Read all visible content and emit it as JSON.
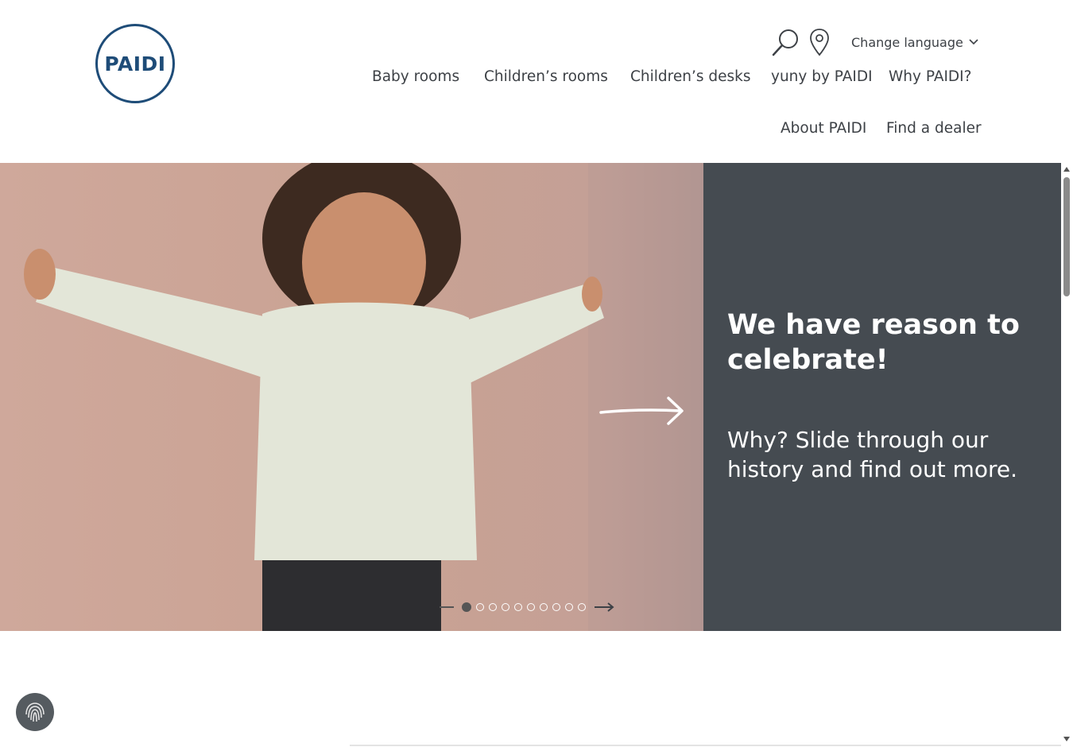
{
  "brand": {
    "logo_text": "PAIDI",
    "logo_color": "#1e4c78"
  },
  "header": {
    "utility": {
      "search_icon": "search-icon",
      "location_icon": "location-pin-icon",
      "language_label": "Change language"
    },
    "nav": [
      {
        "label": "Baby rooms"
      },
      {
        "label": "Children’s rooms"
      },
      {
        "label": "Children’s desks"
      },
      {
        "label": "yuny by PAIDI"
      },
      {
        "label": "Why PAIDI?"
      },
      {
        "label": "About PAIDI"
      },
      {
        "label": "Find a dealer"
      }
    ]
  },
  "hero": {
    "title": "We have reason to celebrate!",
    "subtitle": "Why? Slide through our history and find out more.",
    "panel_color": "#454b51",
    "slides_total": 10,
    "active_slide": 1
  },
  "cookie_button": {
    "icon": "fingerprint-icon"
  }
}
